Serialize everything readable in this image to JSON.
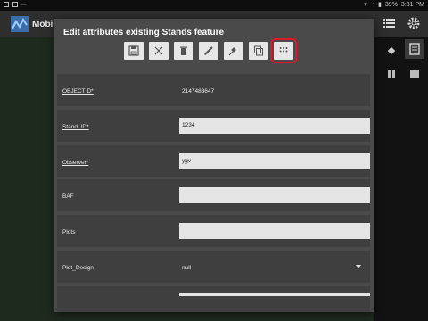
{
  "status": {
    "battery": "39%",
    "time": "3:31 PM",
    "notif": "..."
  },
  "app": {
    "title": "Mobile"
  },
  "dialog": {
    "title": "Edit attributes existing Stands feature",
    "toolbar": {
      "icons": [
        "save-icon",
        "close-icon",
        "delete-icon",
        "edit-icon",
        "gps-icon",
        "copy-icon",
        "grid-icon"
      ]
    },
    "fields": [
      {
        "label": "OBJECTID*",
        "value": "2147483647"
      },
      {
        "label": "Stand_ID*",
        "value": "1234"
      },
      {
        "label": "Observer*",
        "value": "ygv"
      },
      {
        "label": "BAF",
        "value": ""
      },
      {
        "label": "Plots",
        "value": ""
      },
      {
        "label": "Plot_Design",
        "value": "null"
      }
    ]
  }
}
